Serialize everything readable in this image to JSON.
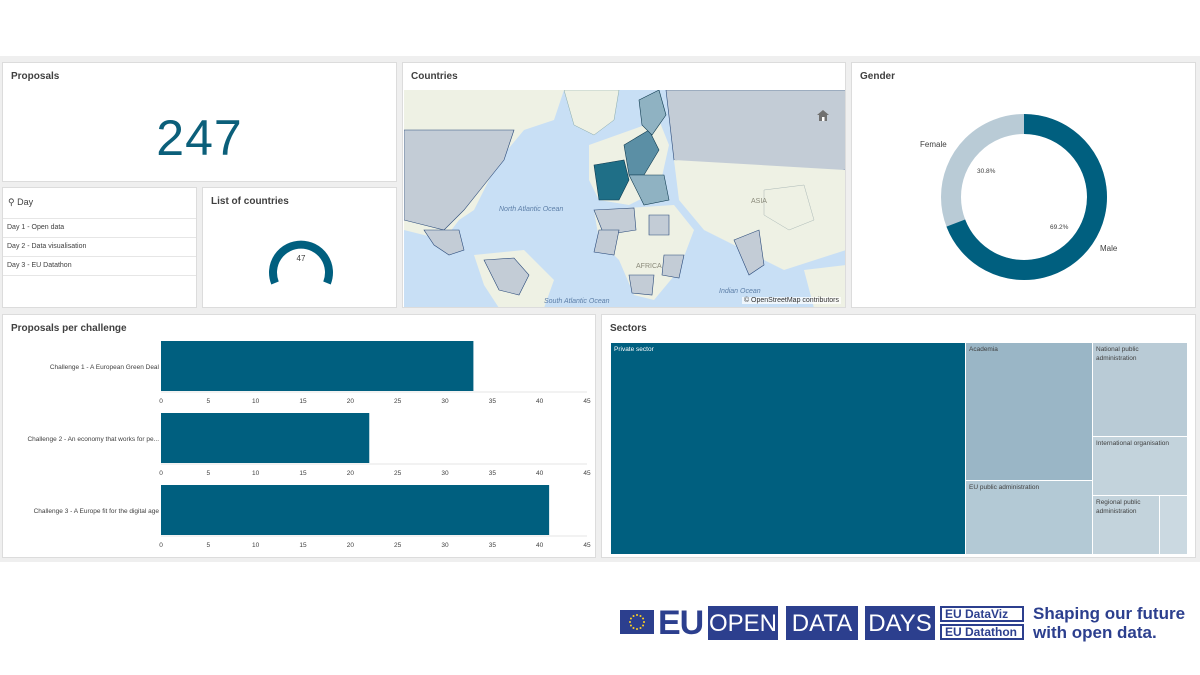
{
  "proposals": {
    "title": "Proposals",
    "value": "247"
  },
  "countries": {
    "title": "Countries",
    "attribution": "© OpenStreetMap contributors",
    "labels": {
      "north_atlantic": "North Atlantic Ocean",
      "south_atlantic": "South Atlantic Ocean",
      "indian": "Indian Ocean",
      "asia": "ASIA",
      "africa": "AFRICA"
    }
  },
  "gender": {
    "title": "Gender",
    "female_label": "Female",
    "male_label": "Male",
    "female_pct": "30.8%",
    "male_pct": "69.2%",
    "female_value": 30.8,
    "male_value": 69.2
  },
  "day_filter": {
    "header": "Day",
    "items": [
      "Day 1 - Open data",
      "Day 2 - Data visualisation",
      "Day 3 - EU Datathon"
    ]
  },
  "list_countries": {
    "title": "List of countries",
    "value": "47"
  },
  "challenges": {
    "title": "Proposals per challenge",
    "chart_data": {
      "type": "bar",
      "categories": [
        "Challenge 1 - A European Green Deal",
        "Challenge 2 - An economy that works for pe...",
        "Challenge 3 - A Europe fit for the digital age"
      ],
      "values": [
        33,
        22,
        41
      ],
      "xlim": [
        0,
        45
      ],
      "ticks": [
        0,
        5,
        10,
        15,
        20,
        25,
        30,
        35,
        40,
        45
      ]
    }
  },
  "sectors": {
    "title": "Sectors",
    "labels": {
      "private": "Private sector",
      "academia": "Academia",
      "eu_public": "EU public administration",
      "national_public": "National public administration",
      "international": "International organisation",
      "regional_public": "Regional public administration"
    }
  },
  "branding": {
    "eu": "EU",
    "open": "OPEN",
    "data": "DATA",
    "days": "DAYS",
    "dataviz": "EU DataViz",
    "datathon": "EU Datathon",
    "slogan_line1": "Shaping our future",
    "slogan_line2": "with open data."
  },
  "colors": {
    "accent": "#005f7f",
    "light": "#b9cbd6",
    "map_water": "#c8dff5",
    "map_land": "#eef1e4",
    "brand_blue": "#2c3f8e"
  }
}
